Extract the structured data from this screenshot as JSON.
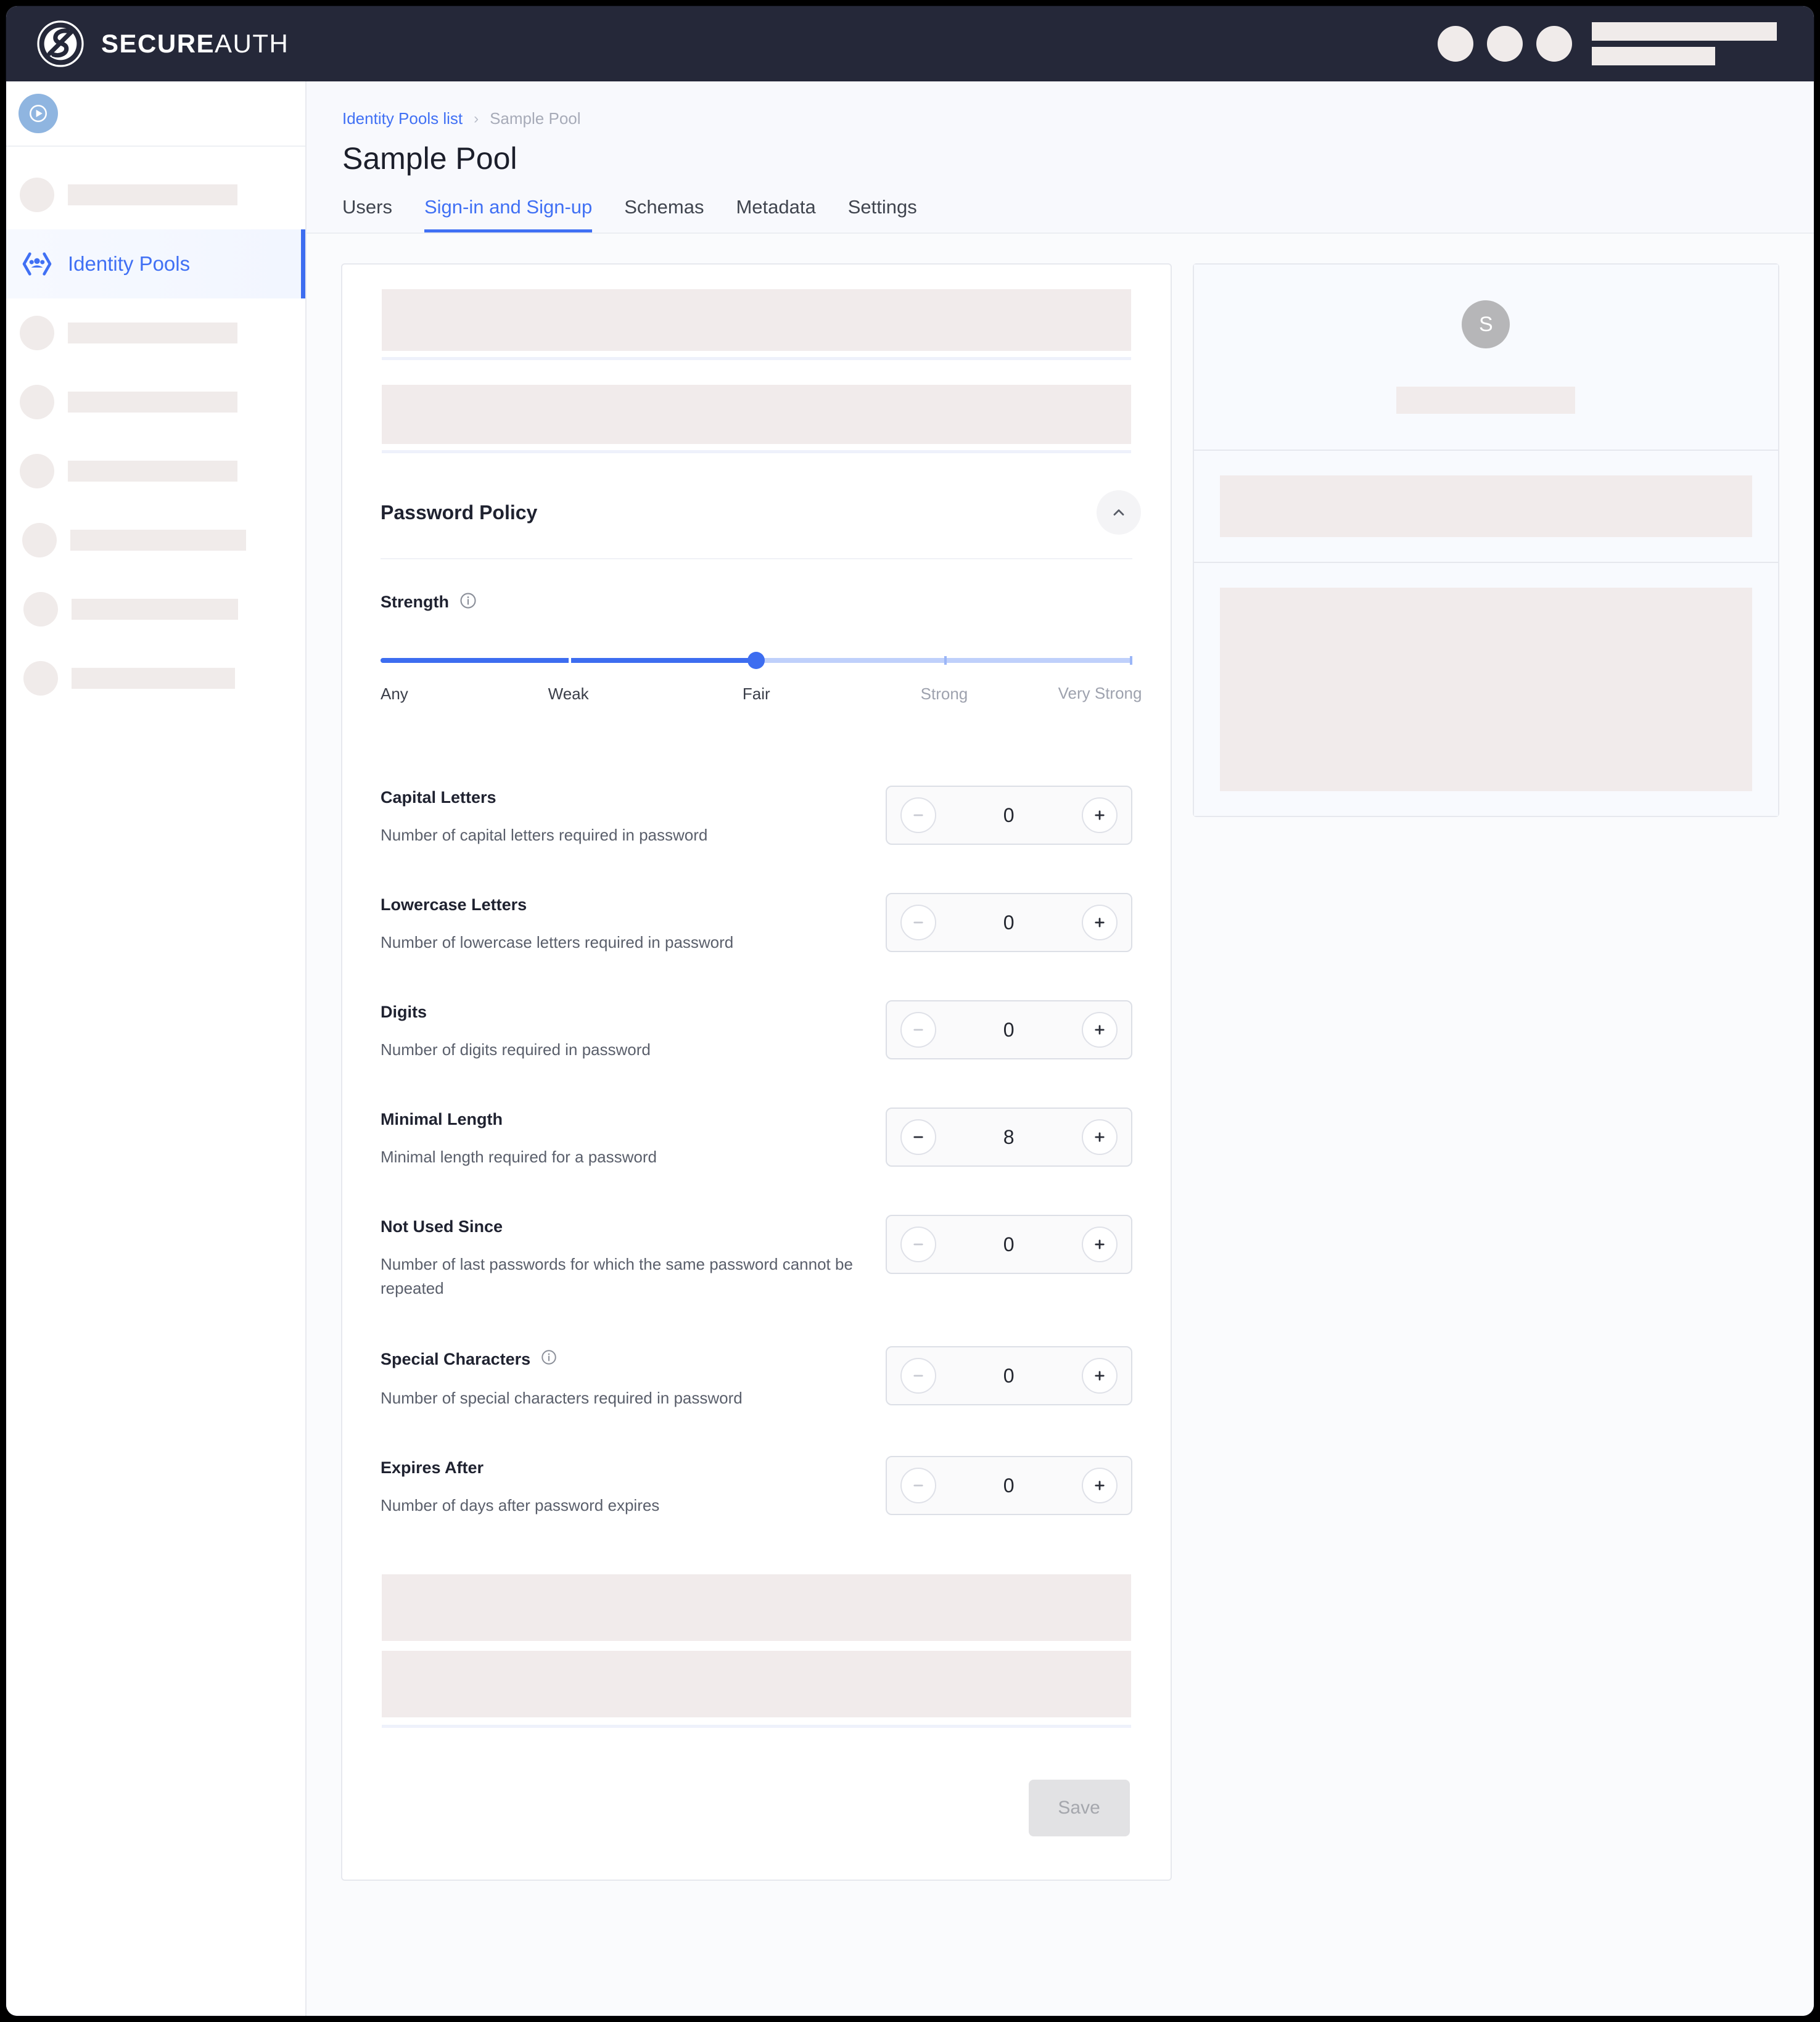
{
  "brand": {
    "name_bold": "SECURE",
    "name_light": "AUTH",
    "logo_icon": "secureauth-circle-s-logo"
  },
  "topbar": {
    "placeholder_circles": 3,
    "placeholder_lines": 2
  },
  "sidebar": {
    "top_badge_icon": "play-circle-icon",
    "active_item": {
      "label": "Identity Pools",
      "icon": "identity-pools-hexagon-icon"
    },
    "skeleton_items_above": 1,
    "skeleton_items_below": 6,
    "skeleton_bar_widths": [
      275,
      275,
      275,
      285,
      270,
      265
    ],
    "skeleton_bar_indents": [
      0,
      0,
      0,
      12,
      14,
      14
    ]
  },
  "breadcrumb": {
    "parent": "Identity Pools list",
    "separator": "›",
    "current": "Sample Pool"
  },
  "page": {
    "title": "Sample Pool"
  },
  "tabs": [
    {
      "label": "Users",
      "active": false
    },
    {
      "label": "Sign-in and Sign-up",
      "active": true
    },
    {
      "label": "Schemas",
      "active": false
    },
    {
      "label": "Metadata",
      "active": false
    },
    {
      "label": "Settings",
      "active": false
    }
  ],
  "password_policy": {
    "section_title": "Password Policy",
    "collapse_icon": "chevron-up-icon",
    "strength": {
      "label": "Strength",
      "info_icon": "info-circle-icon",
      "selected": "Fair",
      "selected_index": 2,
      "options": [
        "Any",
        "Weak",
        "Fair",
        "Strong",
        "Very Strong"
      ]
    },
    "rows": [
      {
        "name": "Capital Letters",
        "desc": "Number of capital letters required in password",
        "value": "0",
        "info": false,
        "minus_enabled": false
      },
      {
        "name": "Lowercase Letters",
        "desc": "Number of lowercase letters required in password",
        "value": "0",
        "info": false,
        "minus_enabled": false
      },
      {
        "name": "Digits",
        "desc": "Number of digits required in password",
        "value": "0",
        "info": false,
        "minus_enabled": false
      },
      {
        "name": "Minimal Length",
        "desc": "Minimal length required for a password",
        "value": "8",
        "info": false,
        "minus_enabled": true
      },
      {
        "name": "Not Used Since",
        "desc": "Number of last passwords for which the same password cannot be repeated",
        "value": "0",
        "info": false,
        "minus_enabled": false
      },
      {
        "name": "Special Characters",
        "desc": "Number of special characters required in password",
        "value": "0",
        "info": true,
        "minus_enabled": false
      },
      {
        "name": "Expires After",
        "desc": "Number of days after password expires",
        "value": "0",
        "info": false,
        "minus_enabled": false
      }
    ],
    "decrement_icon": "minus-circle-icon",
    "increment_icon": "plus-circle-icon"
  },
  "save": {
    "label": "Save",
    "disabled": true
  },
  "right_panel": {
    "avatar_initial": "S"
  },
  "colors": {
    "accent_blue": "#4070f4",
    "topbar_dark": "#252839",
    "skeleton": "#f1ebeb",
    "track_light": "#bfd0fb",
    "page_bg": "#fafbfd"
  }
}
